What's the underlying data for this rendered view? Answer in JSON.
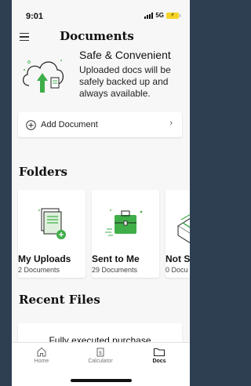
{
  "status_bar": {
    "time": "9:01",
    "network": "5G",
    "battery_icon": "battery-charging-icon"
  },
  "header": {
    "title": "Documents",
    "menu_icon": "menu-icon"
  },
  "promo": {
    "title": "Safe & Convenient",
    "body": "Uploaded docs will be safely backed up and always available.",
    "icon": "cloud-upload-icon"
  },
  "add_document": {
    "label": "Add Document",
    "icon": "plus-circle-icon",
    "chevron": "›"
  },
  "folders": {
    "title": "Folders",
    "items": [
      {
        "name": "My Uploads",
        "count": "2 Documents",
        "icon": "document-upload-icon"
      },
      {
        "name": "Sent to Me",
        "count": "29 Documents",
        "icon": "briefcase-icon"
      },
      {
        "name": "Not S",
        "count": "0 Docu",
        "icon": "box-icon"
      }
    ]
  },
  "recent": {
    "title": "Recent Files",
    "items": [
      {
        "title": "Fully executed purchase agreement"
      }
    ]
  },
  "tab_bar": {
    "tabs": [
      {
        "label": "Home",
        "icon": "home-icon",
        "active": false
      },
      {
        "label": "Calculator",
        "icon": "calculator-icon",
        "active": false
      },
      {
        "label": "Docs",
        "icon": "folder-icon",
        "active": true
      }
    ]
  },
  "colors": {
    "accent_green": "#3fae49",
    "icon_outline": "#222222",
    "background": "#2e3f52"
  }
}
